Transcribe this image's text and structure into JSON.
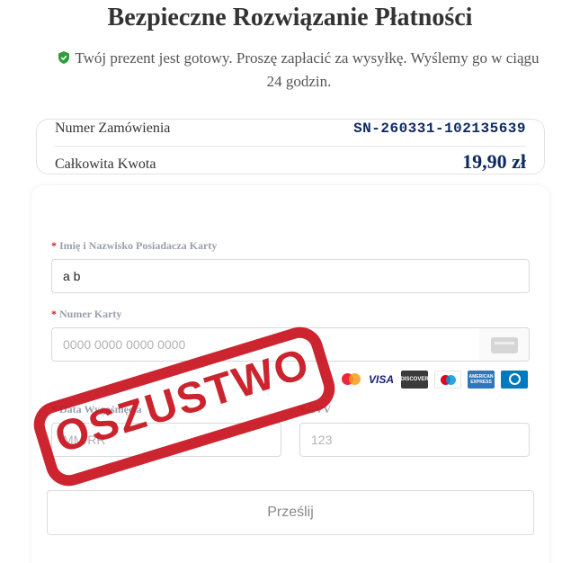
{
  "page": {
    "title": "Bezpieczne Rozwiązanie Płatności",
    "subtitle": "Twój prezent jest gotowy. Proszę zapłacić za wysyłkę. Wyślemy go w ciągu 24 godzin."
  },
  "order": {
    "number_label": "Numer Zamówienia",
    "number_value": "SN-260331-102135639",
    "total_label": "Całkowita Kwota",
    "total_value": "19,90 zł"
  },
  "form": {
    "name_label": "Imię i Nazwisko Posiadacza Karty",
    "name_value": "a b",
    "card_label": "Numer Karty",
    "card_placeholder": "0000 0000 0000 0000",
    "expiry_label": "Data Wygaśnięcia",
    "expiry_placeholder": "MM/RR",
    "cvv_label": "CVV",
    "cvv_placeholder": "123",
    "required_mark": "*",
    "submit_label": "Prześlij"
  },
  "brands": [
    {
      "name": "mastercard-icon",
      "text": "",
      "color": "#ff8a00"
    },
    {
      "name": "visa-icon",
      "text": "VISA",
      "color": "#1a1f71"
    },
    {
      "name": "discover-icon",
      "text": "DISCOVER",
      "color": "#3a3a3a"
    },
    {
      "name": "maestro-icon",
      "text": "",
      "color": "#ffffff"
    },
    {
      "name": "amex-icon",
      "text": "AMERICAN EXPRESS",
      "color": "#2e77bc"
    },
    {
      "name": "diners-icon",
      "text": "",
      "color": "#0079be"
    }
  ],
  "stamp": {
    "text": "OSZUSTWO",
    "color": "#c8141f"
  },
  "colors": {
    "accent": "#0d2a63",
    "required": "#e0202a",
    "shield": "#2e9d3a"
  }
}
